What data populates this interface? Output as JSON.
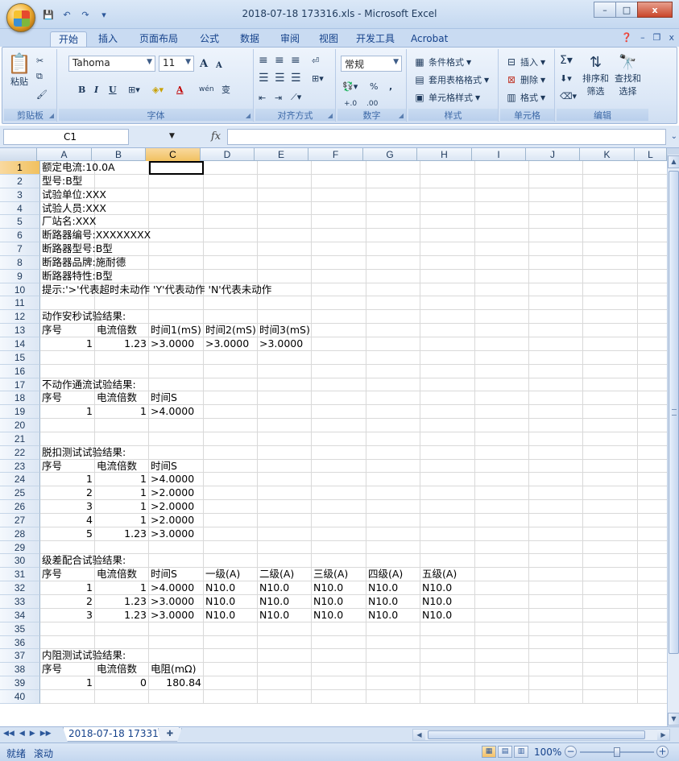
{
  "window": {
    "title": "2018-07-18 173316.xls - Microsoft Excel",
    "controls": {
      "minimize": "–",
      "maximize": "□",
      "close": "x"
    }
  },
  "quick_access": [
    "💾",
    "↶",
    "↷",
    "▾"
  ],
  "tabs": [
    "开始",
    "插入",
    "页面布局",
    "公式",
    "数据",
    "审阅",
    "视图",
    "开发工具",
    "Acrobat"
  ],
  "ribbon": {
    "clipboard": {
      "paste": "粘贴",
      "label": "剪贴板"
    },
    "font": {
      "name": "Tahoma",
      "size": "11",
      "grow": "A",
      "shrink": "A",
      "bold": "B",
      "italic": "I",
      "underline": "U",
      "wen": "wén",
      "change": "变",
      "label": "字体"
    },
    "alignment": {
      "label": "对齐方式"
    },
    "number": {
      "format": "常规",
      "percent": "%",
      "comma": ",",
      "inc": "+.0",
      "dec": ".00",
      "label": "数字"
    },
    "styles": {
      "conditional": "条件格式",
      "table": "套用表格格式",
      "cell": "单元格样式",
      "label": "样式"
    },
    "cells": {
      "insert": "插入",
      "delete": "删除",
      "format": "格式",
      "label": "单元格"
    },
    "editing": {
      "sort": "排序和",
      "sort2": "筛选",
      "find": "查找和",
      "find2": "选择",
      "label": "编辑"
    }
  },
  "formula_bar": {
    "name_box": "C1",
    "fx": "fx",
    "value": ""
  },
  "columns": [
    "A",
    "B",
    "C",
    "D",
    "E",
    "F",
    "G",
    "H",
    "I",
    "J",
    "K",
    "L"
  ],
  "selected": {
    "col": "C",
    "row": 1
  },
  "sheet": {
    "rows": [
      [
        "额定电流:10.0A"
      ],
      [
        "型号:B型"
      ],
      [
        "试验单位:XXX"
      ],
      [
        "试验人员:XXX"
      ],
      [
        "厂站名:XXX"
      ],
      [
        "断路器编号:XXXXXXXX"
      ],
      [
        "断路器型号:B型"
      ],
      [
        "断路器品牌:施耐德"
      ],
      [
        "断路器特性:B型"
      ],
      [
        "提示:'>'代表超时未动作   'Y'代表动作  'N'代表未动作"
      ],
      [],
      [
        "动作安秒试验结果:"
      ],
      [
        "序号",
        "电流倍数",
        "时间1(mS)",
        "时间2(mS)",
        "时间3(mS)"
      ],
      [
        "1",
        "1.23",
        ">3.0000",
        ">3.0000",
        ">3.0000"
      ],
      [],
      [],
      [
        "不动作通流试验结果:"
      ],
      [
        "序号",
        "电流倍数",
        "时间S"
      ],
      [
        "1",
        "1",
        ">4.0000"
      ],
      [],
      [],
      [
        "脱扣测试试验结果:"
      ],
      [
        "序号",
        "电流倍数",
        "时间S"
      ],
      [
        "1",
        "1",
        ">4.0000"
      ],
      [
        "2",
        "1",
        ">2.0000"
      ],
      [
        "3",
        "1",
        ">2.0000"
      ],
      [
        "4",
        "1",
        ">2.0000"
      ],
      [
        "5",
        "1.23",
        ">3.0000"
      ],
      [],
      [
        "级差配合试验结果:"
      ],
      [
        "序号",
        "电流倍数",
        "时间S",
        "一级(A)",
        "二级(A)",
        "三级(A)",
        "四级(A)",
        "五级(A)"
      ],
      [
        "1",
        "1",
        ">4.0000",
        "N10.0",
        "N10.0",
        "N10.0",
        "N10.0",
        "N10.0"
      ],
      [
        "2",
        "1.23",
        ">3.0000",
        "N10.0",
        "N10.0",
        "N10.0",
        "N10.0",
        "N10.0"
      ],
      [
        "3",
        "1.23",
        ">3.0000",
        "N10.0",
        "N10.0",
        "N10.0",
        "N10.0",
        "N10.0"
      ],
      [],
      [],
      [
        "内阻测试试验结果:"
      ],
      [
        "序号",
        "电流倍数",
        "电阻(mΩ)"
      ],
      [
        "1",
        "0",
        "180.84"
      ],
      []
    ]
  },
  "sheet_tabs": {
    "active": "2018-07-18 173316",
    "nav": [
      "◀◀",
      "◀",
      "▶",
      "▶▶"
    ]
  },
  "status": {
    "ready": "就绪",
    "scroll": "滚动",
    "zoom": "100%"
  }
}
